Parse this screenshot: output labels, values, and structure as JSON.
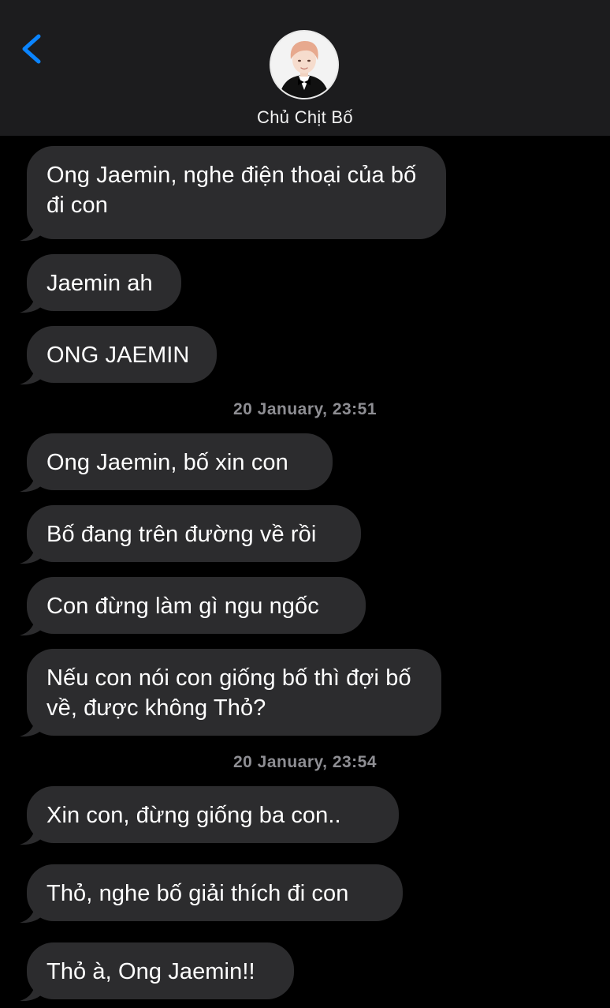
{
  "header": {
    "back_icon": "chevron-left-icon",
    "contact_name": "Chủ Chịt Bố",
    "avatar_icon": "contact-avatar",
    "accent_color": "#0a84ff"
  },
  "timestamps": [
    "20 January, 23:51",
    "20 January, 23:54"
  ],
  "messages": [
    "Ong Jaemin, nghe điện thoại của bố đi con",
    "Jaemin ah",
    "ONG JAEMIN",
    "Ong Jaemin, bố xin con",
    "Bố đang trên đường về rồi",
    "Con đừng làm gì ngu ngốc",
    "Nếu con nói con giống bố thì đợi bố về, được không Thỏ?",
    "Xin con, đừng giống ba con..",
    "Thỏ, nghe bố giải thích đi con",
    "Thỏ à, Ong Jaemin!!"
  ],
  "colors": {
    "background": "#000000",
    "header_background": "#1c1c1e",
    "bubble": "#2c2c2e",
    "timestamp": "#8e8e93"
  }
}
